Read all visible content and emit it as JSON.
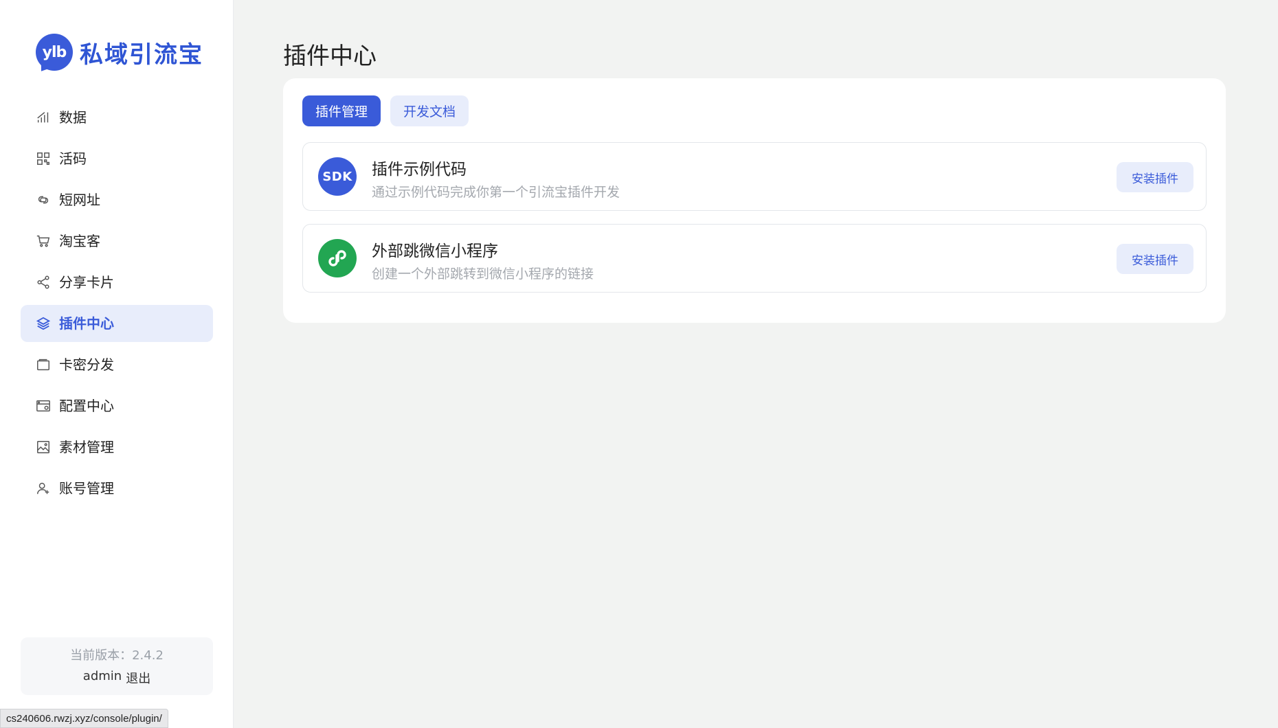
{
  "brand": {
    "logo_text": "ylb",
    "name": "私域引流宝"
  },
  "sidebar": {
    "items": [
      {
        "label": "数据",
        "icon": "bar-chart-icon"
      },
      {
        "label": "活码",
        "icon": "qr-grid-icon"
      },
      {
        "label": "短网址",
        "icon": "link-icon"
      },
      {
        "label": "淘宝客",
        "icon": "cart-icon"
      },
      {
        "label": "分享卡片",
        "icon": "share-icon"
      },
      {
        "label": "插件中心",
        "icon": "layers-icon",
        "active": true
      },
      {
        "label": "卡密分发",
        "icon": "card-icon"
      },
      {
        "label": "配置中心",
        "icon": "config-icon"
      },
      {
        "label": "素材管理",
        "icon": "image-icon"
      },
      {
        "label": "账号管理",
        "icon": "user-add-icon"
      }
    ],
    "footer": {
      "version": "当前版本：2.4.2",
      "user": "admin",
      "logout": "退出"
    }
  },
  "main": {
    "title": "插件中心",
    "tabs": [
      {
        "label": "插件管理",
        "active": true
      },
      {
        "label": "开发文档",
        "active": false
      }
    ],
    "plugins": [
      {
        "icon_text": "SDK",
        "title": "插件示例代码",
        "desc": "通过示例代码完成你第一个引流宝插件开发",
        "action": "安装插件"
      },
      {
        "icon_text": "",
        "title": "外部跳微信小程序",
        "desc": "创建一个外部跳转到微信小程序的链接",
        "action": "安装插件"
      }
    ]
  },
  "status_bar": {
    "url": "cs240606.rwzj.xyz/console/plugin/"
  },
  "colors": {
    "accent": "#3a5bd9",
    "accent_light": "#e8edfb",
    "green": "#22a652",
    "bg": "#f2f3f2"
  }
}
